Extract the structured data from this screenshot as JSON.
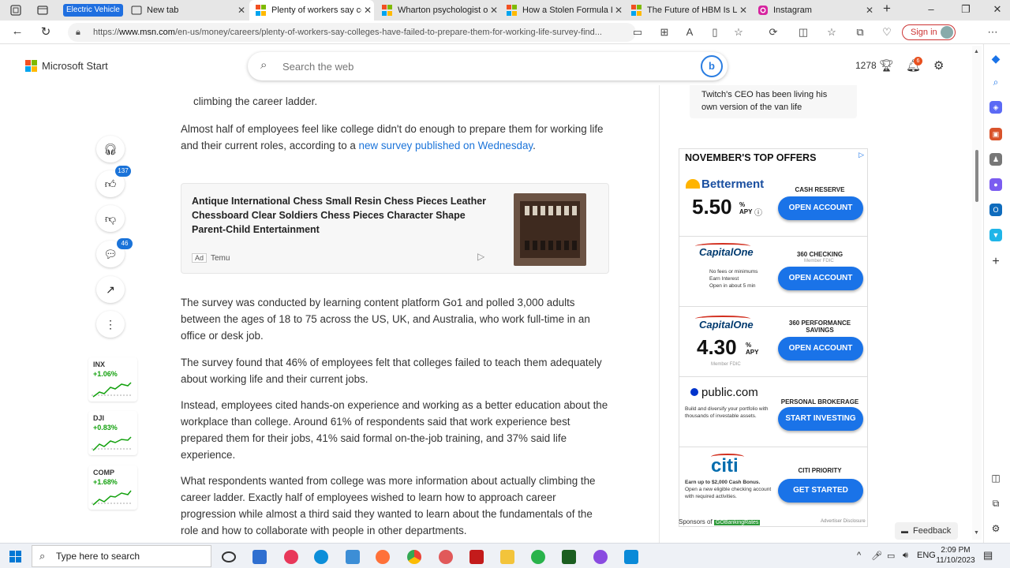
{
  "browser": {
    "tabs": [
      {
        "label": "Electric Vehicle"
      },
      {
        "label": "New tab"
      },
      {
        "label": "Plenty of workers say colleges"
      },
      {
        "label": "Wharton psychologist on"
      },
      {
        "label": "How a Stolen Formula Le"
      },
      {
        "label": "The Future of HBM Is Lig"
      },
      {
        "label": "Instagram"
      }
    ],
    "url_prefix": "https://",
    "url_domain": "www.msn.com",
    "url_path": "/en-us/money/careers/plenty-of-workers-say-colleges-have-failed-to-prepare-them-for-working-life-survey-find...",
    "signin_label": "Sign in"
  },
  "header": {
    "logo_text": "Microsoft Start",
    "search_placeholder": "Search the web",
    "bing_label": "b",
    "points": "1278",
    "notif_count": "6"
  },
  "rail": {
    "like_count": "137",
    "comment_count": "46"
  },
  "stocks": [
    {
      "symbol": "INX",
      "change": "+1.06%"
    },
    {
      "symbol": "DJI",
      "change": "+0.83%"
    },
    {
      "symbol": "COMP",
      "change": "+1.68%"
    }
  ],
  "article": {
    "p0": "climbing the career ladder.",
    "p1_text": "Almost half of employees feel like college didn't do enough to prepare them for working life and their current roles, according to a ",
    "p1_link": "new survey published on Wednesday",
    "p1_end": ".",
    "p2": "The survey was conducted by learning content platform Go1 and polled 3,000 adults between the ages of 18 to 75 across the US, UK, and Australia, who work full-time in an office or desk job.",
    "p3": "The survey found that 46% of employees felt that colleges failed to teach them adequately about working life and their current jobs.",
    "p4": "Instead, employees cited hands-on experience and working as a better education about the workplace than college. Around 61% of respondents said that work experience best prepared them for their jobs, 41% said formal on-the-job training, and 37% said life experience.",
    "p5": "What respondents wanted from college was more information about actually climbing the career ladder. Exactly half of employees wished to learn how to approach career progression while almost a third said they wanted to learn about the fundamentals of the role and how to collaborate with people in other departments."
  },
  "ad": {
    "title": "Antique International Chess Small Resin Chess Pieces Leather Chessboard Clear Soldiers Chess Pieces Character Shape Parent-Child Entertainment",
    "tag": "Ad",
    "source": "Temu"
  },
  "right": {
    "twitch_text": "Twitch's CEO has been living his own version of the van life",
    "offers_header": "NOVEMBER'S TOP OFFERS",
    "offers": [
      {
        "brand": "Betterment",
        "rate": "5.50",
        "apy": "% APY",
        "label": "CASH RESERVE",
        "button": "OPEN ACCOUNT"
      },
      {
        "brand": "CapitalOne",
        "label": "360 CHECKING",
        "sublabel": "Member FDIC",
        "bullets": [
          "No fees or minimums",
          "Earn Interest",
          "Open in about 5 min"
        ],
        "button": "OPEN ACCOUNT"
      },
      {
        "brand": "CapitalOne",
        "rate": "4.30",
        "apy": "% APY",
        "fdic": "Member FDIC",
        "label": "360 PERFORMANCE SAVINGS",
        "button": "OPEN ACCOUNT"
      },
      {
        "brand": "public.com",
        "desc": "Build and diversify your portfolio with thousands of investable assets.",
        "label": "PERSONAL BROKERAGE",
        "button": "START INVESTING"
      },
      {
        "brand": "citi",
        "desc_bold": "Earn up to $2,000 Cash Bonus.",
        "desc": "Open a new eligible checking account with required activities.",
        "label": "CITI PRIORITY",
        "button": "GET STARTED"
      }
    ],
    "sponsors": "Sponsors of",
    "sponsor_brand": "GOBankingRates",
    "advertiser_disclosure": "Advertiser Disclosure",
    "feedback": "Feedback"
  },
  "taskbar": {
    "search_placeholder": "Type here to search",
    "lang": "ENG",
    "time": "2:09 PM",
    "date": "11/10/2023"
  }
}
